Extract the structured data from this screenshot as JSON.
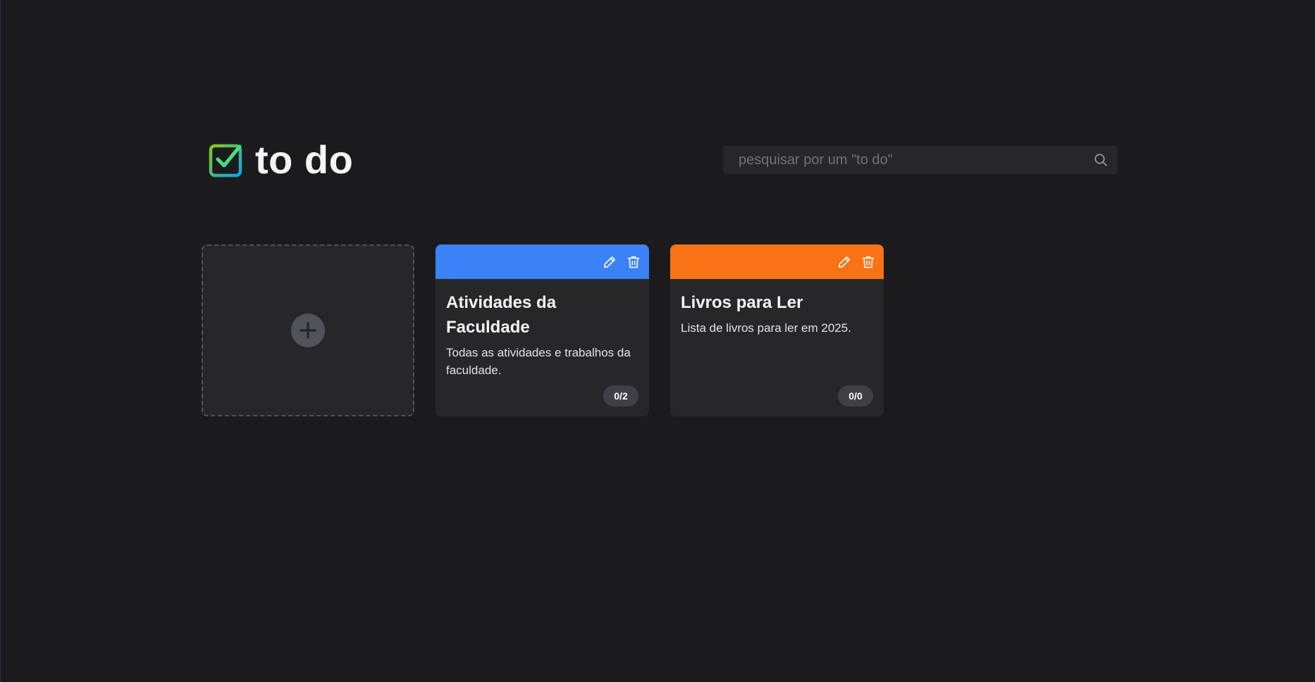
{
  "header": {
    "title": "to do",
    "logo_icon": "checkbox-checked-icon"
  },
  "search": {
    "placeholder": "pesquisar por um \"to do\"",
    "value": "",
    "icon": "search-icon"
  },
  "add_card": {
    "icon": "plus-icon"
  },
  "lists": [
    {
      "title": "Atividades da Faculdade",
      "description": "Todas as atividades e trabalhos da faculdade.",
      "count": "0/2",
      "color": "#3b82f6"
    },
    {
      "title": "Livros para Ler",
      "description": "Lista de livros para ler em 2025.",
      "count": "0/0",
      "color": "#f97316"
    }
  ],
  "colors": {
    "background": "#1b1b1e",
    "card": "#27272a",
    "logo_gradient_start": "#84cc16",
    "logo_gradient_end": "#0ea5e9"
  },
  "card_actions": {
    "edit_icon": "pencil-icon",
    "delete_icon": "trash-icon"
  }
}
